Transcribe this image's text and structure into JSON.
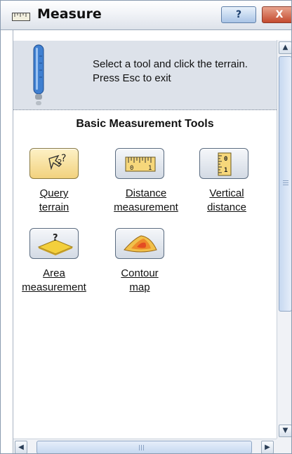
{
  "window": {
    "title": "Measure",
    "help_label": "?",
    "close_label": "X"
  },
  "info": {
    "line1": "Select a tool and click the terrain.",
    "line2": "Press Esc to exit"
  },
  "section": {
    "title": "Basic Measurement Tools"
  },
  "tools": [
    {
      "line1": "Query",
      "line2": "terrain",
      "icon": "query-terrain-icon"
    },
    {
      "line1": "Distance",
      "line2": "measurement",
      "icon": "ruler-icon"
    },
    {
      "line1": "Vertical",
      "line2": "distance",
      "icon": "vertical-ruler-icon"
    },
    {
      "line1": "Area",
      "line2": "measurement",
      "icon": "area-icon"
    },
    {
      "line1": "Contour",
      "line2": "map",
      "icon": "contour-map-icon"
    }
  ],
  "icon_text": {
    "query_exponent": "?",
    "ruler_0": "0",
    "ruler_1": "1",
    "area_q": "?"
  },
  "colors": {
    "accent_blue": "#4a86d4",
    "selected_tool": "#f2d27e",
    "close_red": "#c44a2e"
  }
}
